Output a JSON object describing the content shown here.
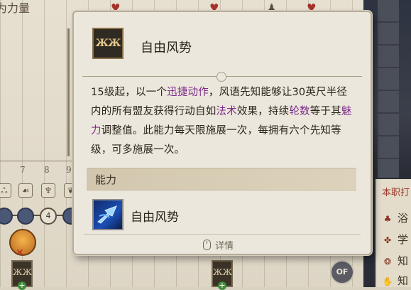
{
  "background": {
    "title_fragment": "为力量",
    "column_numbers": [
      "7",
      "8",
      "9"
    ],
    "node_value": "4",
    "slot_label": "ЖЖ",
    "coin_label": "OF",
    "side_panel": {
      "header": "本职打",
      "rows": [
        {
          "icon": "claw-icon",
          "label": "浴"
        },
        {
          "icon": "scroll-icon",
          "label": "学"
        },
        {
          "icon": "spiral-icon",
          "label": "知"
        },
        {
          "icon": "hand-icon",
          "label": "知"
        }
      ]
    }
  },
  "tooltip": {
    "icon_label": "ЖЖ",
    "title": "自由风势",
    "description_parts": [
      {
        "text": "15级起，以一个",
        "kw": false
      },
      {
        "text": "迅捷动作",
        "kw": true
      },
      {
        "text": "，风语先知能够让30英尺半径内的所有盟友获得行动自如",
        "kw": false
      },
      {
        "text": "法术",
        "kw": true
      },
      {
        "text": "效果，持续",
        "kw": false
      },
      {
        "text": "轮数",
        "kw": true
      },
      {
        "text": "等于其",
        "kw": false
      },
      {
        "text": "魅力",
        "kw": true
      },
      {
        "text": "调整值。此能力每天限施展一次，每拥有六个先知等级，可多施展一次。",
        "kw": false
      }
    ],
    "section_label": "能力",
    "ability_name": "自由风势",
    "footer_label": "详情"
  },
  "colors": {
    "keyword": "#7b2a8a",
    "tooltip_bg": "#ece7dc",
    "section_bar": "#d2c7ae"
  }
}
